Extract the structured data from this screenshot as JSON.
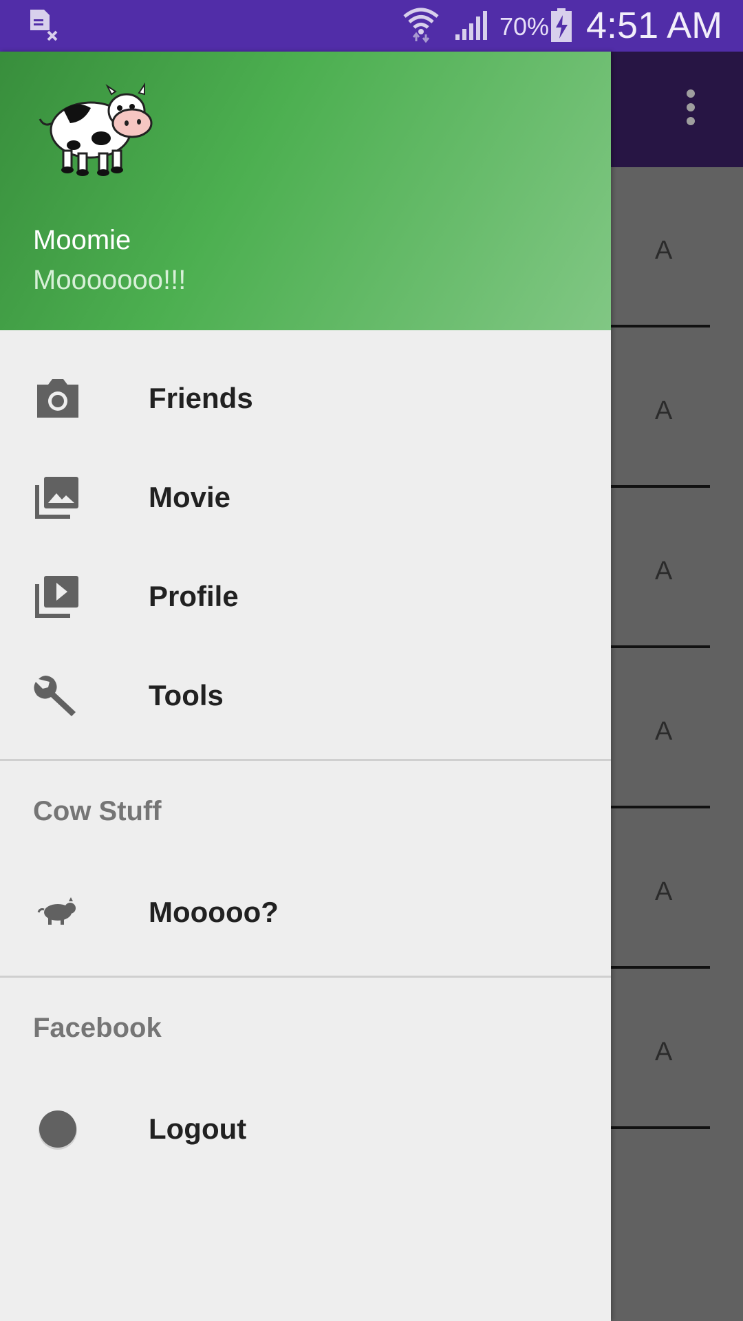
{
  "status_bar": {
    "battery_percent": "70%",
    "time": "4:51 AM",
    "icons": [
      "notification-icon",
      "wifi-icon",
      "signal-icon",
      "battery-charging-icon"
    ]
  },
  "background_app": {
    "overflow_icon": "more-vert-icon",
    "rows": [
      "A",
      "A",
      "A",
      "A",
      "A",
      "A"
    ]
  },
  "drawer": {
    "header": {
      "avatar_icon": "cow-icon",
      "name": "Moomie",
      "status": "Mooooooo!!!"
    },
    "main_items": [
      {
        "label": "Friends",
        "icon": "camera-icon"
      },
      {
        "label": "Movie",
        "icon": "gallery-icon"
      },
      {
        "label": "Profile",
        "icon": "video-library-icon"
      },
      {
        "label": "Tools",
        "icon": "wrench-icon"
      }
    ],
    "sections": [
      {
        "title": "Cow Stuff",
        "items": [
          {
            "label": "Mooooo?",
            "icon": "cow-silhouette-icon"
          }
        ]
      },
      {
        "title": "Facebook",
        "items": [
          {
            "label": "Logout",
            "icon": "circle-icon"
          }
        ]
      }
    ]
  }
}
